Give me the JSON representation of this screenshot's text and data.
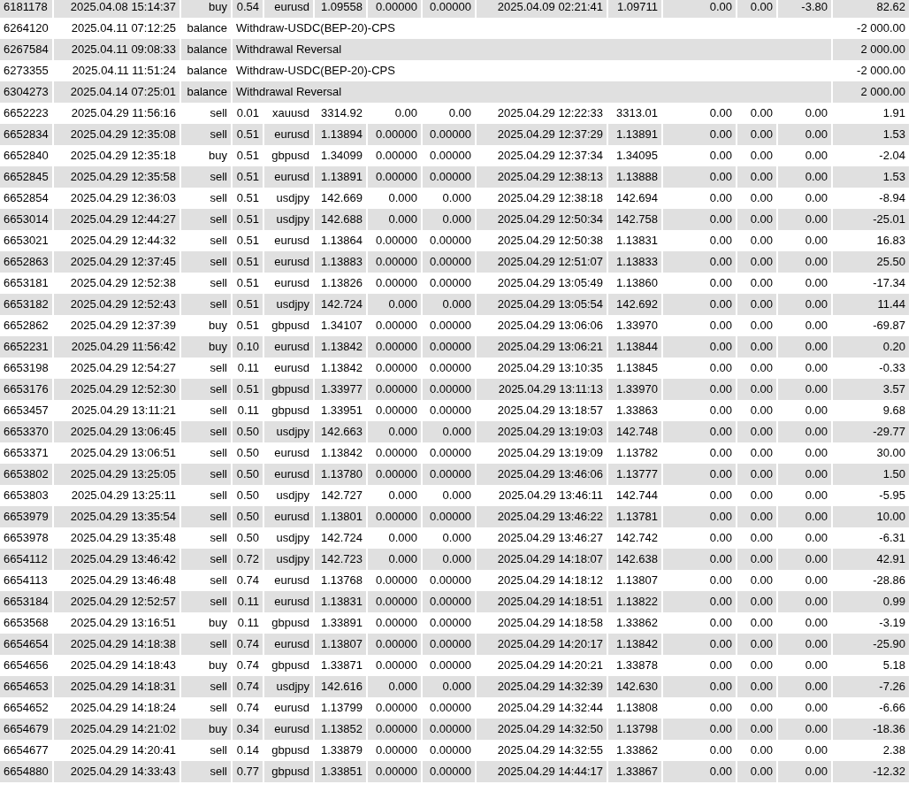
{
  "rows": [
    {
      "kind": "trade",
      "cells": [
        "6181178",
        "2025.04.08 15:14:37",
        "buy",
        "0.54",
        "eurusd",
        "1.09558",
        "0.00000",
        "0.00000",
        "2025.04.09 02:21:41",
        "1.09711",
        "0.00",
        "0.00",
        "-3.80",
        "82.62"
      ]
    },
    {
      "kind": "balance",
      "cells": [
        "6264120",
        "2025.04.11 07:12:25",
        "balance",
        "Withdraw-USDC(BEP-20)-CPS",
        "-2 000.00"
      ]
    },
    {
      "kind": "balance",
      "cells": [
        "6267584",
        "2025.04.11 09:08:33",
        "balance",
        "Withdrawal Reversal",
        "2 000.00"
      ]
    },
    {
      "kind": "balance",
      "cells": [
        "6273355",
        "2025.04.11 11:51:24",
        "balance",
        "Withdraw-USDC(BEP-20)-CPS",
        "-2 000.00"
      ]
    },
    {
      "kind": "balance",
      "cells": [
        "6304273",
        "2025.04.14 07:25:01",
        "balance",
        "Withdrawal Reversal",
        "2 000.00"
      ]
    },
    {
      "kind": "trade",
      "cells": [
        "6652223",
        "2025.04.29 11:56:16",
        "sell",
        "0.01",
        "xauusd",
        "3314.92",
        "0.00",
        "0.00",
        "2025.04.29 12:22:33",
        "3313.01",
        "0.00",
        "0.00",
        "0.00",
        "1.91"
      ]
    },
    {
      "kind": "trade",
      "cells": [
        "6652834",
        "2025.04.29 12:35:08",
        "sell",
        "0.51",
        "eurusd",
        "1.13894",
        "0.00000",
        "0.00000",
        "2025.04.29 12:37:29",
        "1.13891",
        "0.00",
        "0.00",
        "0.00",
        "1.53"
      ]
    },
    {
      "kind": "trade",
      "cells": [
        "6652840",
        "2025.04.29 12:35:18",
        "buy",
        "0.51",
        "gbpusd",
        "1.34099",
        "0.00000",
        "0.00000",
        "2025.04.29 12:37:34",
        "1.34095",
        "0.00",
        "0.00",
        "0.00",
        "-2.04"
      ]
    },
    {
      "kind": "trade",
      "cells": [
        "6652845",
        "2025.04.29 12:35:58",
        "sell",
        "0.51",
        "eurusd",
        "1.13891",
        "0.00000",
        "0.00000",
        "2025.04.29 12:38:13",
        "1.13888",
        "0.00",
        "0.00",
        "0.00",
        "1.53"
      ]
    },
    {
      "kind": "trade",
      "cells": [
        "6652854",
        "2025.04.29 12:36:03",
        "sell",
        "0.51",
        "usdjpy",
        "142.669",
        "0.000",
        "0.000",
        "2025.04.29 12:38:18",
        "142.694",
        "0.00",
        "0.00",
        "0.00",
        "-8.94"
      ]
    },
    {
      "kind": "trade",
      "cells": [
        "6653014",
        "2025.04.29 12:44:27",
        "sell",
        "0.51",
        "usdjpy",
        "142.688",
        "0.000",
        "0.000",
        "2025.04.29 12:50:34",
        "142.758",
        "0.00",
        "0.00",
        "0.00",
        "-25.01"
      ]
    },
    {
      "kind": "trade",
      "cells": [
        "6653021",
        "2025.04.29 12:44:32",
        "sell",
        "0.51",
        "eurusd",
        "1.13864",
        "0.00000",
        "0.00000",
        "2025.04.29 12:50:38",
        "1.13831",
        "0.00",
        "0.00",
        "0.00",
        "16.83"
      ]
    },
    {
      "kind": "trade",
      "cells": [
        "6652863",
        "2025.04.29 12:37:45",
        "sell",
        "0.51",
        "eurusd",
        "1.13883",
        "0.00000",
        "0.00000",
        "2025.04.29 12:51:07",
        "1.13833",
        "0.00",
        "0.00",
        "0.00",
        "25.50"
      ]
    },
    {
      "kind": "trade",
      "cells": [
        "6653181",
        "2025.04.29 12:52:38",
        "sell",
        "0.51",
        "eurusd",
        "1.13826",
        "0.00000",
        "0.00000",
        "2025.04.29 13:05:49",
        "1.13860",
        "0.00",
        "0.00",
        "0.00",
        "-17.34"
      ]
    },
    {
      "kind": "trade",
      "cells": [
        "6653182",
        "2025.04.29 12:52:43",
        "sell",
        "0.51",
        "usdjpy",
        "142.724",
        "0.000",
        "0.000",
        "2025.04.29 13:05:54",
        "142.692",
        "0.00",
        "0.00",
        "0.00",
        "11.44"
      ]
    },
    {
      "kind": "trade",
      "cells": [
        "6652862",
        "2025.04.29 12:37:39",
        "buy",
        "0.51",
        "gbpusd",
        "1.34107",
        "0.00000",
        "0.00000",
        "2025.04.29 13:06:06",
        "1.33970",
        "0.00",
        "0.00",
        "0.00",
        "-69.87"
      ]
    },
    {
      "kind": "trade",
      "cells": [
        "6652231",
        "2025.04.29 11:56:42",
        "buy",
        "0.10",
        "eurusd",
        "1.13842",
        "0.00000",
        "0.00000",
        "2025.04.29 13:06:21",
        "1.13844",
        "0.00",
        "0.00",
        "0.00",
        "0.20"
      ]
    },
    {
      "kind": "trade",
      "cells": [
        "6653198",
        "2025.04.29 12:54:27",
        "sell",
        "0.11",
        "eurusd",
        "1.13842",
        "0.00000",
        "0.00000",
        "2025.04.29 13:10:35",
        "1.13845",
        "0.00",
        "0.00",
        "0.00",
        "-0.33"
      ]
    },
    {
      "kind": "trade",
      "cells": [
        "6653176",
        "2025.04.29 12:52:30",
        "sell",
        "0.51",
        "gbpusd",
        "1.33977",
        "0.00000",
        "0.00000",
        "2025.04.29 13:11:13",
        "1.33970",
        "0.00",
        "0.00",
        "0.00",
        "3.57"
      ]
    },
    {
      "kind": "trade",
      "cells": [
        "6653457",
        "2025.04.29 13:11:21",
        "sell",
        "0.11",
        "gbpusd",
        "1.33951",
        "0.00000",
        "0.00000",
        "2025.04.29 13:18:57",
        "1.33863",
        "0.00",
        "0.00",
        "0.00",
        "9.68"
      ]
    },
    {
      "kind": "trade",
      "cells": [
        "6653370",
        "2025.04.29 13:06:45",
        "sell",
        "0.50",
        "usdjpy",
        "142.663",
        "0.000",
        "0.000",
        "2025.04.29 13:19:03",
        "142.748",
        "0.00",
        "0.00",
        "0.00",
        "-29.77"
      ]
    },
    {
      "kind": "trade",
      "cells": [
        "6653371",
        "2025.04.29 13:06:51",
        "sell",
        "0.50",
        "eurusd",
        "1.13842",
        "0.00000",
        "0.00000",
        "2025.04.29 13:19:09",
        "1.13782",
        "0.00",
        "0.00",
        "0.00",
        "30.00"
      ]
    },
    {
      "kind": "trade",
      "cells": [
        "6653802",
        "2025.04.29 13:25:05",
        "sell",
        "0.50",
        "eurusd",
        "1.13780",
        "0.00000",
        "0.00000",
        "2025.04.29 13:46:06",
        "1.13777",
        "0.00",
        "0.00",
        "0.00",
        "1.50"
      ]
    },
    {
      "kind": "trade",
      "cells": [
        "6653803",
        "2025.04.29 13:25:11",
        "sell",
        "0.50",
        "usdjpy",
        "142.727",
        "0.000",
        "0.000",
        "2025.04.29 13:46:11",
        "142.744",
        "0.00",
        "0.00",
        "0.00",
        "-5.95"
      ]
    },
    {
      "kind": "trade",
      "cells": [
        "6653979",
        "2025.04.29 13:35:54",
        "sell",
        "0.50",
        "eurusd",
        "1.13801",
        "0.00000",
        "0.00000",
        "2025.04.29 13:46:22",
        "1.13781",
        "0.00",
        "0.00",
        "0.00",
        "10.00"
      ]
    },
    {
      "kind": "trade",
      "cells": [
        "6653978",
        "2025.04.29 13:35:48",
        "sell",
        "0.50",
        "usdjpy",
        "142.724",
        "0.000",
        "0.000",
        "2025.04.29 13:46:27",
        "142.742",
        "0.00",
        "0.00",
        "0.00",
        "-6.31"
      ]
    },
    {
      "kind": "trade",
      "cells": [
        "6654112",
        "2025.04.29 13:46:42",
        "sell",
        "0.72",
        "usdjpy",
        "142.723",
        "0.000",
        "0.000",
        "2025.04.29 14:18:07",
        "142.638",
        "0.00",
        "0.00",
        "0.00",
        "42.91"
      ]
    },
    {
      "kind": "trade",
      "cells": [
        "6654113",
        "2025.04.29 13:46:48",
        "sell",
        "0.74",
        "eurusd",
        "1.13768",
        "0.00000",
        "0.00000",
        "2025.04.29 14:18:12",
        "1.13807",
        "0.00",
        "0.00",
        "0.00",
        "-28.86"
      ]
    },
    {
      "kind": "trade",
      "cells": [
        "6653184",
        "2025.04.29 12:52:57",
        "sell",
        "0.11",
        "eurusd",
        "1.13831",
        "0.00000",
        "0.00000",
        "2025.04.29 14:18:51",
        "1.13822",
        "0.00",
        "0.00",
        "0.00",
        "0.99"
      ]
    },
    {
      "kind": "trade",
      "cells": [
        "6653568",
        "2025.04.29 13:16:51",
        "buy",
        "0.11",
        "gbpusd",
        "1.33891",
        "0.00000",
        "0.00000",
        "2025.04.29 14:18:58",
        "1.33862",
        "0.00",
        "0.00",
        "0.00",
        "-3.19"
      ]
    },
    {
      "kind": "trade",
      "cells": [
        "6654654",
        "2025.04.29 14:18:38",
        "sell",
        "0.74",
        "eurusd",
        "1.13807",
        "0.00000",
        "0.00000",
        "2025.04.29 14:20:17",
        "1.13842",
        "0.00",
        "0.00",
        "0.00",
        "-25.90"
      ]
    },
    {
      "kind": "trade",
      "cells": [
        "6654656",
        "2025.04.29 14:18:43",
        "buy",
        "0.74",
        "gbpusd",
        "1.33871",
        "0.00000",
        "0.00000",
        "2025.04.29 14:20:21",
        "1.33878",
        "0.00",
        "0.00",
        "0.00",
        "5.18"
      ]
    },
    {
      "kind": "trade",
      "cells": [
        "6654653",
        "2025.04.29 14:18:31",
        "sell",
        "0.74",
        "usdjpy",
        "142.616",
        "0.000",
        "0.000",
        "2025.04.29 14:32:39",
        "142.630",
        "0.00",
        "0.00",
        "0.00",
        "-7.26"
      ]
    },
    {
      "kind": "trade",
      "cells": [
        "6654652",
        "2025.04.29 14:18:24",
        "sell",
        "0.74",
        "eurusd",
        "1.13799",
        "0.00000",
        "0.00000",
        "2025.04.29 14:32:44",
        "1.13808",
        "0.00",
        "0.00",
        "0.00",
        "-6.66"
      ]
    },
    {
      "kind": "trade",
      "cells": [
        "6654679",
        "2025.04.29 14:21:02",
        "buy",
        "0.34",
        "eurusd",
        "1.13852",
        "0.00000",
        "0.00000",
        "2025.04.29 14:32:50",
        "1.13798",
        "0.00",
        "0.00",
        "0.00",
        "-18.36"
      ]
    },
    {
      "kind": "trade",
      "cells": [
        "6654677",
        "2025.04.29 14:20:41",
        "sell",
        "0.14",
        "gbpusd",
        "1.33879",
        "0.00000",
        "0.00000",
        "2025.04.29 14:32:55",
        "1.33862",
        "0.00",
        "0.00",
        "0.00",
        "2.38"
      ]
    },
    {
      "kind": "trade",
      "cells": [
        "6654880",
        "2025.04.29 14:33:43",
        "sell",
        "0.77",
        "gbpusd",
        "1.33851",
        "0.00000",
        "0.00000",
        "2025.04.29 14:44:17",
        "1.33867",
        "0.00",
        "0.00",
        "0.00",
        "-12.32"
      ]
    }
  ]
}
